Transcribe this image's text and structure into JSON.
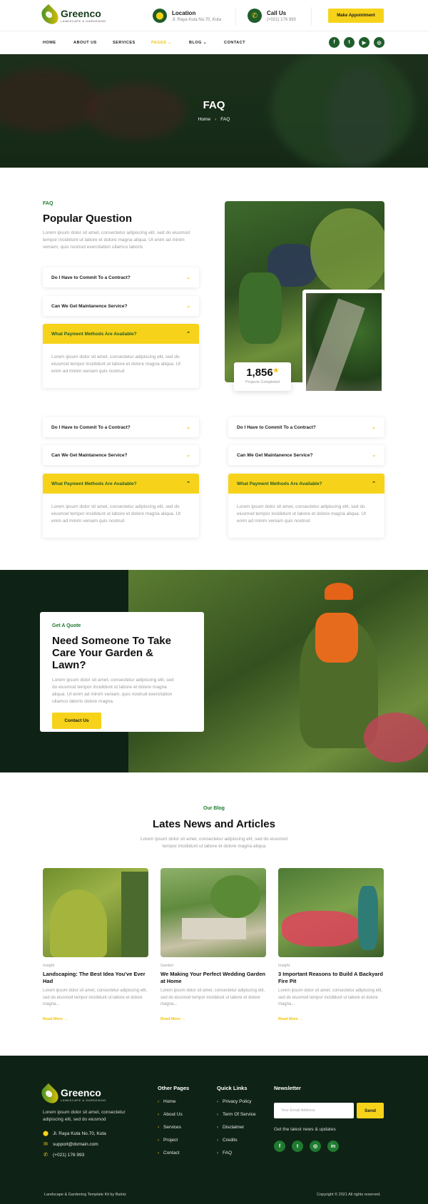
{
  "brand": {
    "name": "Greenco",
    "tagline": "Landscape & Gardening",
    "accent": "#f6d31a",
    "dark_green": "#0f2216",
    "green": "#1f5d2b"
  },
  "header": {
    "location_label": "Location",
    "location_value": "Jl. Raya Kuta No.70, Kuta",
    "call_label": "Call Us",
    "call_value": "(+021) 176 993",
    "appointment_button": "Make Appointment"
  },
  "nav": {
    "items": [
      {
        "label": "Home"
      },
      {
        "label": "About Us"
      },
      {
        "label": "Services"
      },
      {
        "label": "Pages",
        "chevron": "chevron-down-icon",
        "active": true
      },
      {
        "label": "Blog",
        "chevron": "chevron-down-icon"
      },
      {
        "label": "Contact"
      }
    ],
    "social": [
      "f",
      "t",
      "▶",
      "◎"
    ]
  },
  "hero": {
    "title": "FAQ",
    "crumb_home": "Home",
    "crumb_sep": "›",
    "crumb_current": "FAQ"
  },
  "faq": {
    "kicker": "FAQ",
    "title": "Popular Question",
    "intro": "Lorem ipsum dolor sit amet, consectetur adipiscing elit, sed do eiusmod tempor incididunt ut labore et dolore magna aliqua. Ut enim ad minim veniam, quis nostrud exercitation ullamco laboris",
    "q1": "Do I Have to Commit To a Contract?",
    "q2": "Can We Get Maintanence Service?",
    "q3": "What Payment Methods Are Available?",
    "answer": "Lorem ipsum dolor sit amet, consectetur adipiscing elit, sed do eiusmod tempor incididunt ut labore et dolore magna aliqua. Ut enim ad minim veniam quis nostrud",
    "counter_value": "1,856",
    "counter_star": "★",
    "counter_label": "Projects Completed"
  },
  "quote": {
    "kicker": "Get A Quote",
    "title": "Need Someone To Take Care Your Garden & Lawn?",
    "text": "Lorem ipsum dolor sit amet, consectetur adipiscing elit, sed do eiusmod tempor incididunt ut labore et dolore magna aliqua. Ut enim ad minim veniam, quis nostrud exercitation ullamco laboris dolore magna.",
    "button": "Contact Us"
  },
  "blog": {
    "kicker": "Our Blog",
    "title": "Lates News and Articles",
    "intro": "Lorem ipsum dolor sit amet, consectetur adipiscing elit, sed do eiusmod tempor incididunt ut labore et dolore magna aliqua",
    "posts": [
      {
        "category": "Insight",
        "title": "Landscaping: The Best Idea You've Ever Had",
        "excerpt": "Lorem ipsum dolor sit amet, consectetur adipiscing elit, sed do eiusmod tempor incididunt ut labore et dolore magna...",
        "more": "Read More →"
      },
      {
        "category": "Garden",
        "title": "We Making Your Perfect Wedding Garden at Home",
        "excerpt": "Lorem ipsum dolor sit amet, consectetur adipiscing elit, sed do eiusmod tempor incididunt ut labore et dolore magna...",
        "more": "Read More →"
      },
      {
        "category": "Insight",
        "title": "3 Important Reasons to Build A Backyard Fire Pit",
        "excerpt": "Lorem ipsum dolor sit amet, consectetur adipiscing elit, sed do eiusmod tempor incididunt ut labore et dolore magna...",
        "more": "Read More →"
      }
    ]
  },
  "footer": {
    "about": "Lorem ipsum dolor sit amet, consectetur adipiscing elit, sed do eiusmod",
    "address": "Jl. Raya Kuta No.70, Kuta",
    "email": "support@domain.com",
    "phone": "(+021) 176 993",
    "other_title": "Other Pages",
    "other_links": [
      "Home",
      "About Us",
      "Services",
      "Project",
      "Contact"
    ],
    "quick_title": "Quick Links",
    "quick_links": [
      "Privacy Policy",
      "Term Of Service",
      "Disclaimer",
      "Credits",
      "FAQ"
    ],
    "newsletter_title": "Newsletter",
    "newsletter_placeholder": "Your Email Address",
    "newsletter_button": "Send",
    "newsletter_note": "Get the latest news & updates",
    "social": [
      "f",
      "t",
      "◎",
      "in"
    ],
    "credit": "Landscape & Gardening Template Kit by Balniz",
    "copyright": "Copyright © 2021 All rights reserved."
  }
}
